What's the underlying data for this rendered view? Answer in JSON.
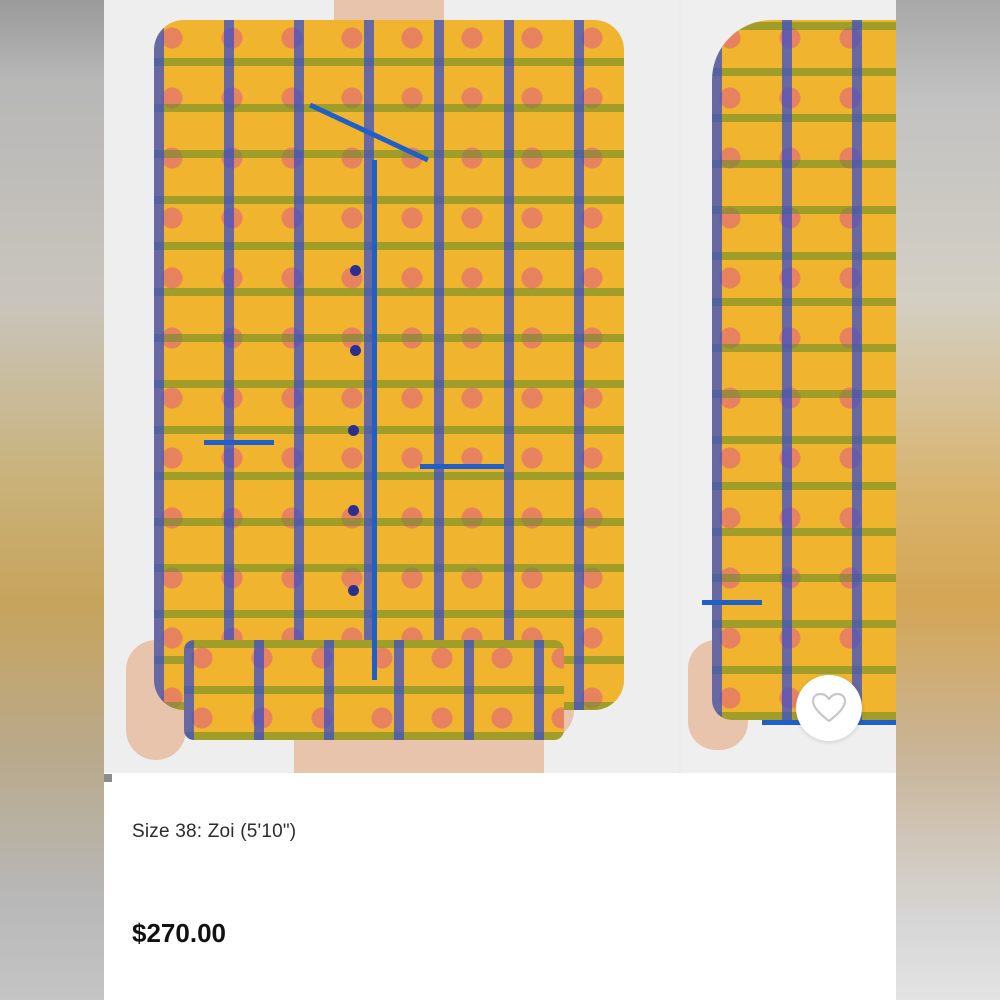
{
  "product": {
    "model_info": "Size 38: Zoi (5'10\")",
    "price": "$270.00"
  },
  "gallery": {
    "images": [
      "model-front-photo",
      "model-side-photo"
    ],
    "active_index": 0
  },
  "icons": {
    "favorite": "heart-outline-icon"
  },
  "colors": {
    "price_text": "#111111",
    "body_text": "#2b2b2b",
    "fabric_base": "#f0b42f",
    "piping_blue": "#1f5fc9"
  }
}
